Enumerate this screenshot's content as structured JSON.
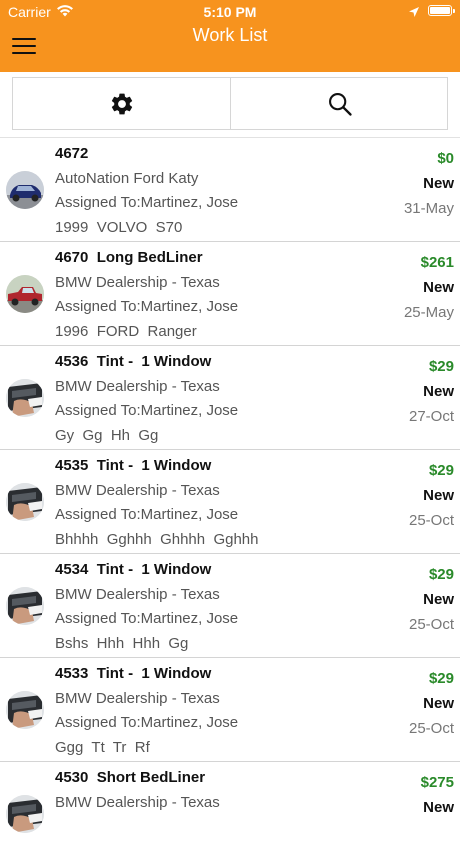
{
  "status_bar": {
    "carrier": "Carrier",
    "time": "5:10 PM"
  },
  "nav": {
    "title": "Work List"
  },
  "toolbar": {
    "settings_icon": "gear-icon",
    "search_icon": "search-icon"
  },
  "colors": {
    "header": "#F7931E",
    "amount": "#2a8a2a"
  },
  "work_items": [
    {
      "title": "4672",
      "dealer": "AutoNation Ford Katy",
      "assigned": "Assigned To:Martinez, Jose",
      "vehicle": "1999  VOLVO  S70",
      "amount": "$0",
      "status": "New",
      "date": "31-May",
      "thumb": "blue-car"
    },
    {
      "title": "4670  Long BedLiner",
      "dealer": "BMW Dealership - Texas",
      "assigned": "Assigned To:Martinez, Jose",
      "vehicle": "1996  FORD  Ranger",
      "amount": "$261",
      "status": "New",
      "date": "25-May",
      "thumb": "red-truck"
    },
    {
      "title": "4536  Tint -  1 Window",
      "dealer": "BMW Dealership - Texas",
      "assigned": "Assigned To:Martinez, Jose",
      "vehicle": "Gy  Gg  Hh  Gg",
      "amount": "$29",
      "status": "New",
      "date": "27-Oct",
      "thumb": "tint"
    },
    {
      "title": "4535  Tint -  1 Window",
      "dealer": "BMW Dealership - Texas",
      "assigned": "Assigned To:Martinez, Jose",
      "vehicle": "Bhhhh  Gghhh  Ghhhh  Gghhh",
      "amount": "$29",
      "status": "New",
      "date": "25-Oct",
      "thumb": "tint"
    },
    {
      "title": "4534  Tint -  1 Window",
      "dealer": "BMW Dealership - Texas",
      "assigned": "Assigned To:Martinez, Jose",
      "vehicle": "Bshs  Hhh  Hhh  Gg",
      "amount": "$29",
      "status": "New",
      "date": "25-Oct",
      "thumb": "tint"
    },
    {
      "title": "4533  Tint -  1 Window",
      "dealer": "BMW Dealership - Texas",
      "assigned": "Assigned To:Martinez, Jose",
      "vehicle": "Ggg  Tt  Tr  Rf",
      "amount": "$29",
      "status": "New",
      "date": "25-Oct",
      "thumb": "tint"
    },
    {
      "title": "4530  Short BedLiner",
      "dealer": "BMW Dealership - Texas",
      "assigned": "",
      "vehicle": "",
      "amount": "$275",
      "status": "New",
      "date": "",
      "thumb": "tint"
    }
  ]
}
